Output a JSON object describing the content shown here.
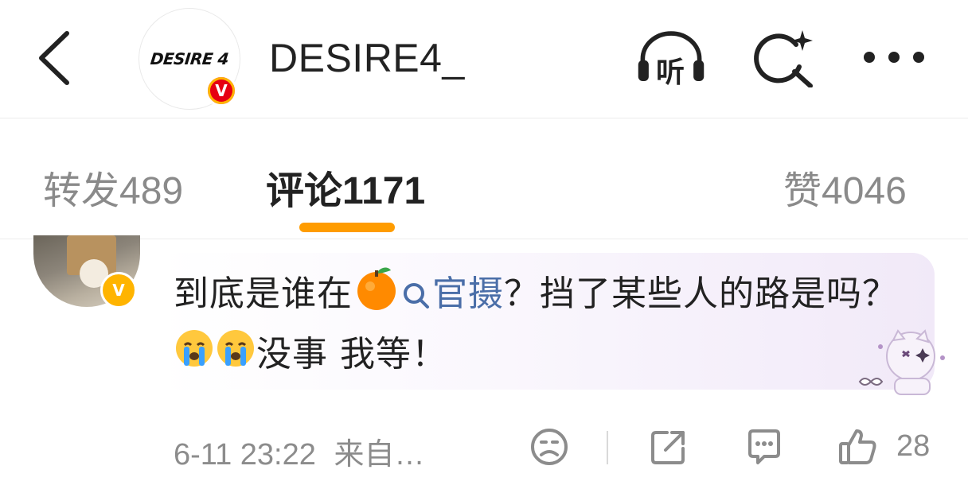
{
  "header": {
    "title": "DESIRE4_",
    "avatar_logo_text": "DESIRE 4",
    "verified_badge": "V",
    "listen_icon_label": "听",
    "icons": [
      "back-icon",
      "listen-headphones-icon",
      "search-sparkle-icon",
      "more-dots-icon"
    ]
  },
  "tabs": [
    {
      "label": "转发",
      "count": "489"
    },
    {
      "label": "评论",
      "count": "1171"
    },
    {
      "label": "赞",
      "count": "4046"
    }
  ],
  "active_tab": "评论",
  "colors": {
    "accent": "#ff9c00",
    "link": "#4a6ea8",
    "verified": "#ffb400"
  },
  "comment": {
    "text_part1": "到底是谁在",
    "link_text": "官摄",
    "text_part2": "？挡了某些人的路是吗？",
    "text_part3": "没事 我等！",
    "emojis": [
      "orange-emoji",
      "crying-emoji",
      "crying-emoji"
    ],
    "verified_badge": "V",
    "time": "6-11 23:22",
    "source": "来自…",
    "likes": "28"
  }
}
